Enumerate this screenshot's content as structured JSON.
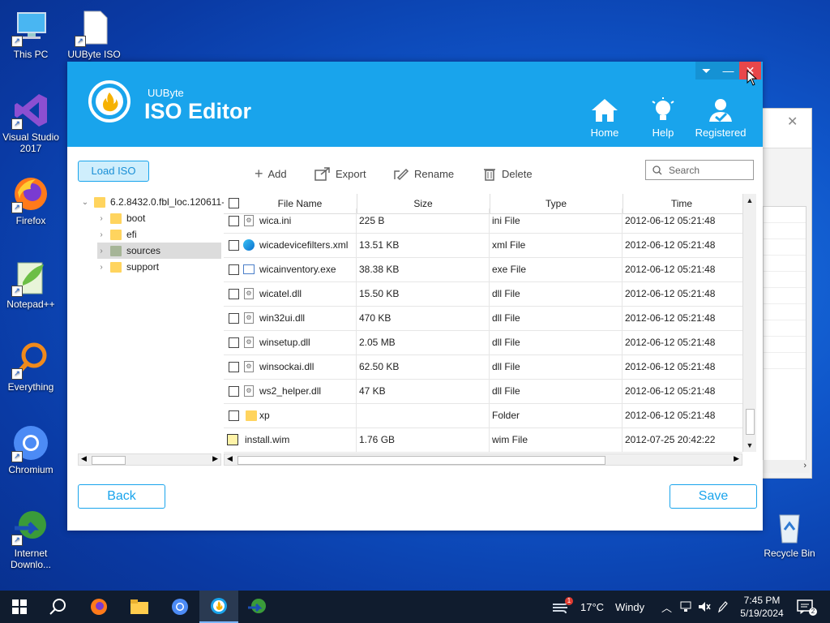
{
  "desktop": {
    "icons": [
      {
        "label": "This PC"
      },
      {
        "label": "UUByte ISO"
      },
      {
        "label": "Visual Studio 2017"
      },
      {
        "label": "Firefox"
      },
      {
        "label": "Notepad++"
      },
      {
        "label": "Everything"
      },
      {
        "label": "Chromium"
      },
      {
        "label": "Internet Downlo..."
      },
      {
        "label": "Recycle Bin"
      }
    ]
  },
  "app": {
    "brand_small": "UUByte",
    "brand_big": "ISO Editor",
    "nav": {
      "home": "Home",
      "help": "Help",
      "registered": "Registered"
    },
    "load_iso": "Load ISO",
    "toolbar": {
      "add": "Add",
      "export": "Export",
      "rename": "Rename",
      "delete": "Delete"
    },
    "search_placeholder": "Search",
    "tree": {
      "root": "6.2.8432.0.fbl_loc.120611-",
      "children": [
        "boot",
        "efi",
        "sources",
        "support"
      ],
      "selected": "sources"
    },
    "table": {
      "columns": [
        "File Name",
        "Size",
        "Type",
        "Time"
      ],
      "rows": [
        {
          "name": "wica.ini",
          "size": "225 B",
          "type": "ini File",
          "time": "2012-06-12 05:21:48"
        },
        {
          "name": "wicadevicefilters.xml",
          "size": "13.51 KB",
          "type": "xml File",
          "time": "2012-06-12 05:21:48"
        },
        {
          "name": "wicainventory.exe",
          "size": "38.38 KB",
          "type": "exe File",
          "time": "2012-06-12 05:21:48"
        },
        {
          "name": "wicatel.dll",
          "size": "15.50 KB",
          "type": "dll File",
          "time": "2012-06-12 05:21:48"
        },
        {
          "name": "win32ui.dll",
          "size": "470 KB",
          "type": "dll File",
          "time": "2012-06-12 05:21:48"
        },
        {
          "name": "winsetup.dll",
          "size": "2.05 MB",
          "type": "dll File",
          "time": "2012-06-12 05:21:48"
        },
        {
          "name": "winsockai.dll",
          "size": "62.50 KB",
          "type": "dll File",
          "time": "2012-06-12 05:21:48"
        },
        {
          "name": "ws2_helper.dll",
          "size": "47 KB",
          "type": "dll File",
          "time": "2012-06-12 05:21:48"
        },
        {
          "name": "xp",
          "size": "",
          "type": "Folder",
          "time": "2012-06-12 05:21:48"
        },
        {
          "name": "install.wim",
          "size": "1.76 GB",
          "type": "wim File",
          "time": "2012-07-25 20:42:22"
        }
      ]
    },
    "back": "Back",
    "save": "Save"
  },
  "taskbar": {
    "weather_temp": "17°C",
    "weather_desc": "Windy",
    "notification_count": "1",
    "time": "7:45 PM",
    "date": "5/19/2024"
  },
  "colors": {
    "accent": "#19a4ec",
    "taskbar": "#101c2e"
  }
}
